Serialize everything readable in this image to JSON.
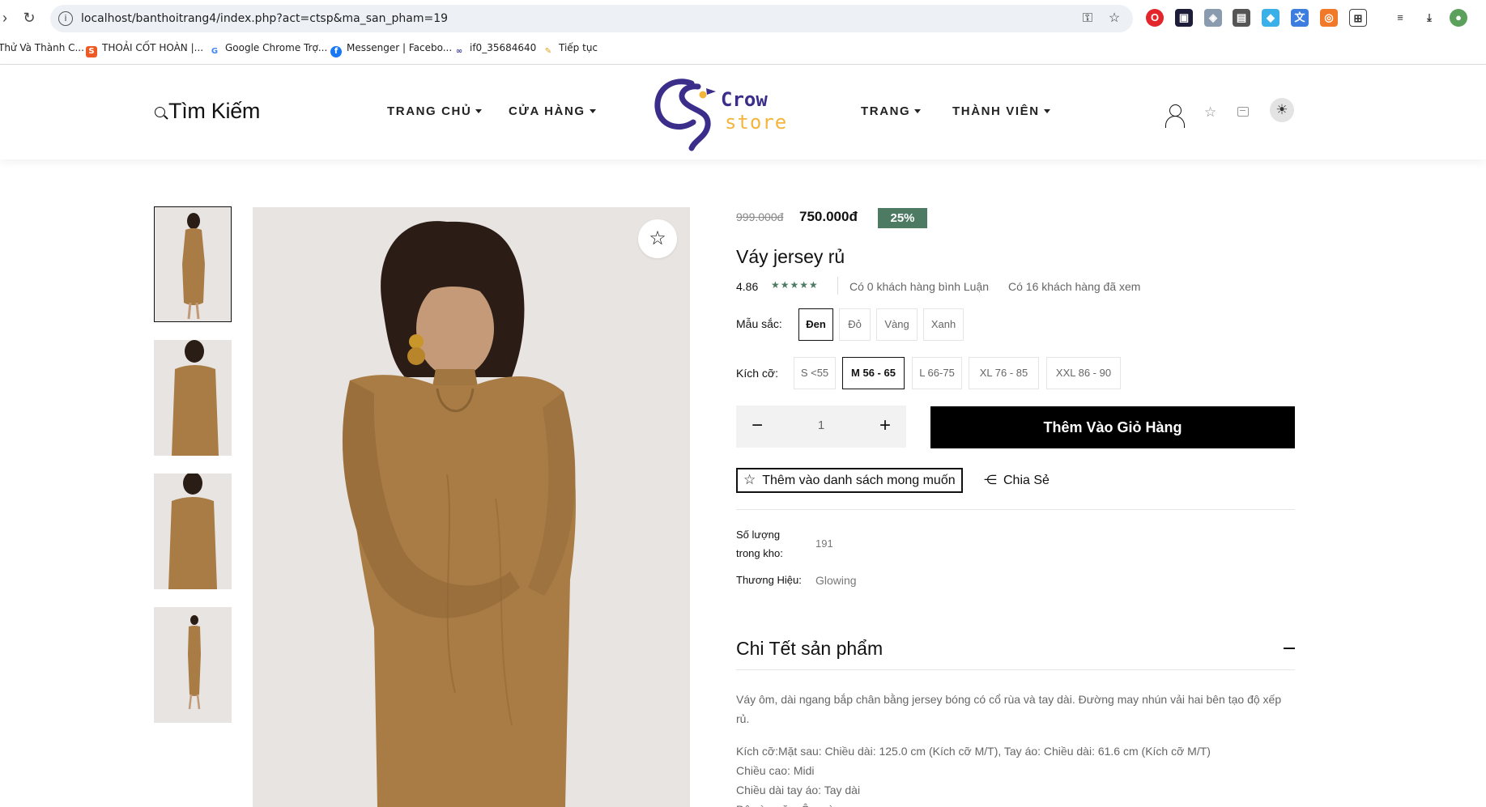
{
  "browser": {
    "url": "localhost/banthoitrang4/index.php?act=ctsp&ma_san_pham=19",
    "bookmarks": [
      "Thử Và Thành C...",
      "THOẢI CỐT HOÀN |...",
      "Google Chrome Trợ...",
      "Messenger | Facebo...",
      "if0_35684640",
      "Tiếp tục"
    ]
  },
  "header": {
    "search_label": "Tìm Kiếm",
    "nav": [
      "TRANG CHỦ",
      "CỬA HÀNG",
      "TRANG",
      "THÀNH VIÊN"
    ],
    "logo_line1": "Crow",
    "logo_line2": "store"
  },
  "product": {
    "old_price": "999.000đ",
    "new_price": "750.000đ",
    "discount": "25%",
    "title": "Váy jersey rủ",
    "rating": "4.86",
    "stars": "★★★★★",
    "comment_count": "Có 0 khách hàng bình Luận",
    "view_count": "Có 16 khách hàng đã xem",
    "color_label": "Mẫu sắc:",
    "colors": [
      "Đen",
      "Đỏ",
      "Vàng",
      "Xanh"
    ],
    "size_label": "Kích cỡ:",
    "sizes": [
      "S <55",
      "M 56 - 65",
      "L 66-75",
      "XL 76 - 85",
      "XXL 86 - 90"
    ],
    "quantity": "1",
    "add_to_cart": "Thêm Vào Giỏ Hàng",
    "wishlist_label": "Thêm vào danh sách mong muốn",
    "share_label": "Chia Sẻ",
    "stock_label_1": "Số lượng",
    "stock_label_2": "trong kho:",
    "stock_value": "191",
    "brand_label": "Thương Hiệu:",
    "brand_value": "Glowing",
    "detail_title": "Chi Tết sản phẩm",
    "description": "Váy ôm, dài ngang bắp chân bằng jersey bóng có cổ rùa và tay dài. Đường may nhún vải hai bên tạo độ xếp rủ.",
    "detail_lines": [
      "Kích cỡ:Mặt sau: Chiều dài: 125.0 cm (Kích cỡ M/T), Tay áo: Chiều dài: 61.6 cm (Kích cỡ M/T)",
      "Chiều cao: Midi",
      "Chiều dài tay áo: Tay dài",
      "Độ vừa vặn: Ôm vừa"
    ]
  },
  "colors": {
    "accent_green": "#4d7a63",
    "dress_camel": "#a97c45",
    "logo_purple": "#3b2d8a",
    "logo_gold": "#f3b63c"
  }
}
